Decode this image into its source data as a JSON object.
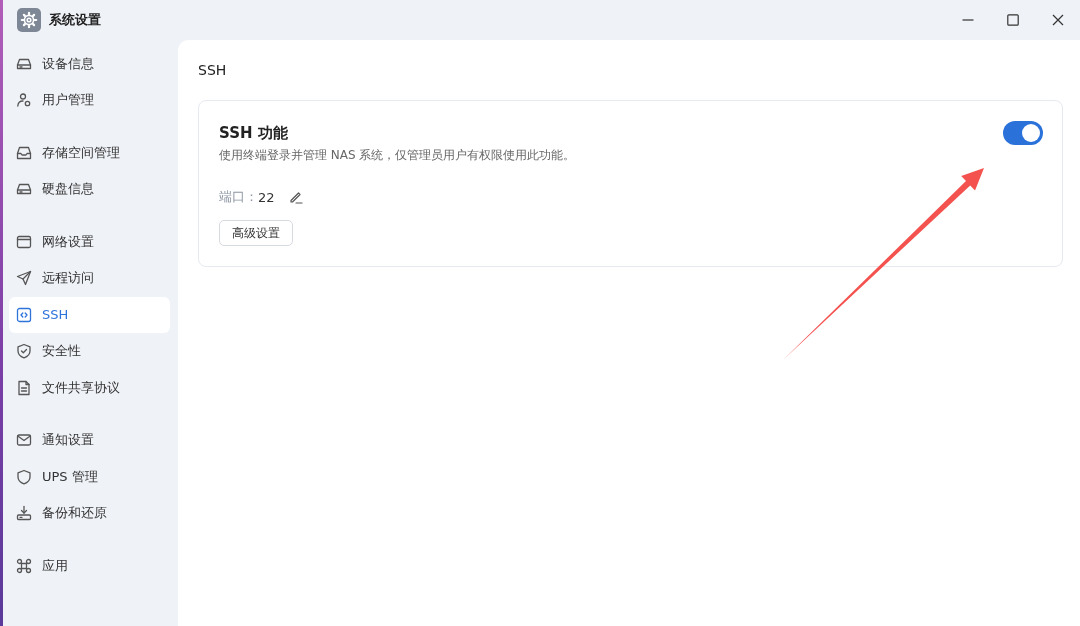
{
  "window": {
    "title": "系统设置"
  },
  "sidebar": {
    "groups": [
      {
        "items": [
          {
            "label": "设备信息",
            "selected": false
          },
          {
            "label": "用户管理",
            "selected": false
          }
        ]
      },
      {
        "items": [
          {
            "label": "存储空间管理",
            "selected": false
          },
          {
            "label": "硬盘信息",
            "selected": false
          }
        ]
      },
      {
        "items": [
          {
            "label": "网络设置",
            "selected": false
          },
          {
            "label": "远程访问",
            "selected": false
          },
          {
            "label": "SSH",
            "selected": true
          },
          {
            "label": "安全性",
            "selected": false
          },
          {
            "label": "文件共享协议",
            "selected": false
          }
        ]
      },
      {
        "items": [
          {
            "label": "通知设置",
            "selected": false
          },
          {
            "label": "UPS 管理",
            "selected": false
          },
          {
            "label": "备份和还原",
            "selected": false
          }
        ]
      },
      {
        "items": [
          {
            "label": "应用",
            "selected": false
          }
        ]
      }
    ]
  },
  "content": {
    "title": "SSH",
    "card": {
      "title": "SSH 功能",
      "description": "使用终端登录并管理 NAS 系统，仅管理员用户有权限使用此功能。",
      "toggle": {
        "on": true
      },
      "port_label": "端口：",
      "port_value": "22",
      "button": "高级设置"
    }
  }
}
